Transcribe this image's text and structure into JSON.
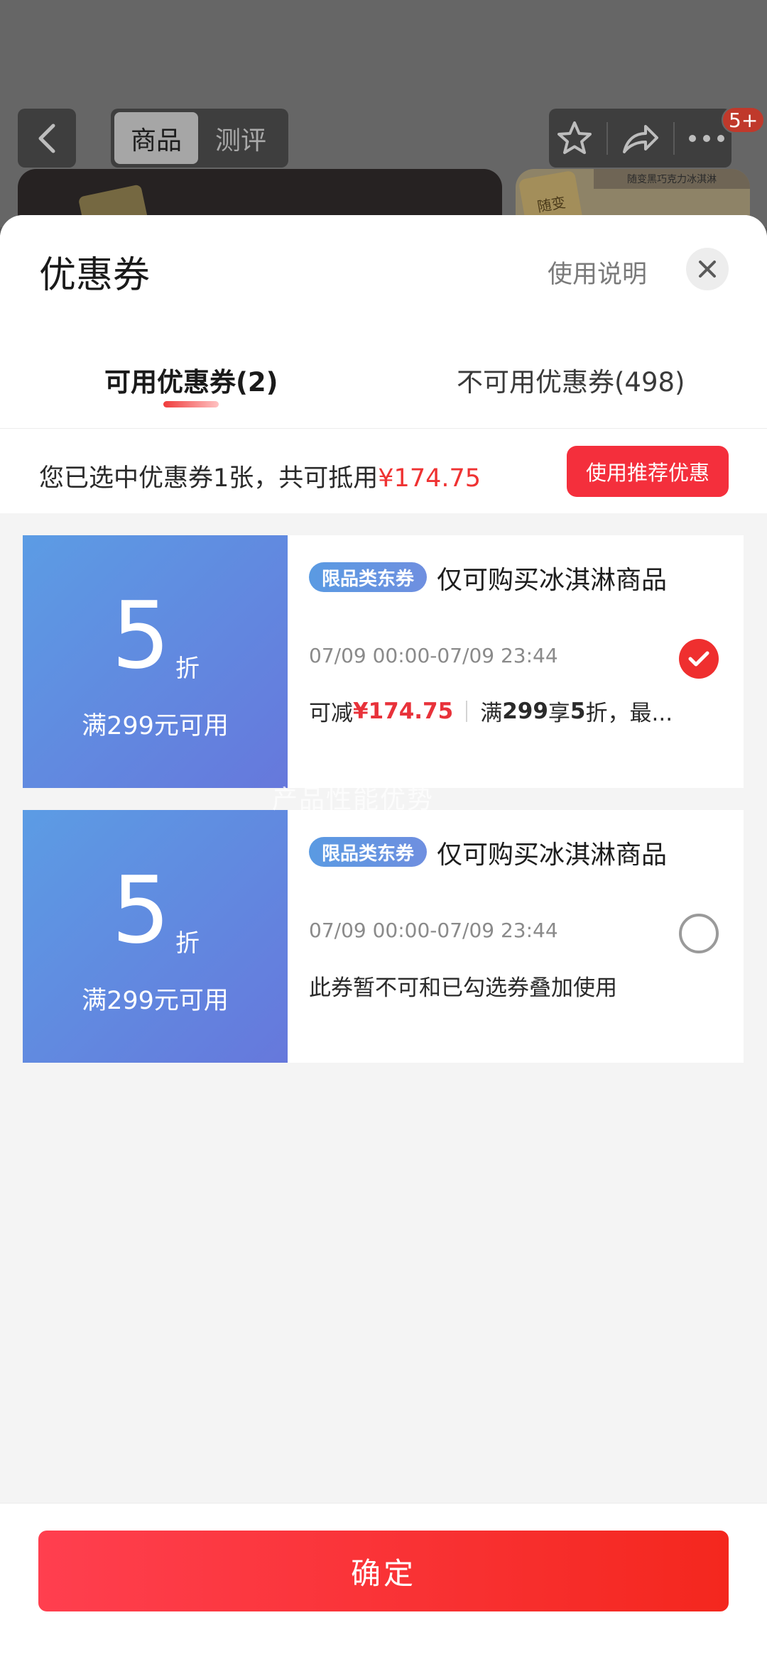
{
  "background_page": {
    "segment_tabs": [
      {
        "label": "商品",
        "active": true
      },
      {
        "label": "测评",
        "active": false
      }
    ],
    "notification_badge": "5+",
    "side_banner_text": "随变黑巧克力冰淇淋",
    "side_logo_text": "随变"
  },
  "sheet": {
    "title": "优惠券",
    "help_link": "使用说明",
    "tabs": [
      {
        "label": "可用优惠券(2)",
        "active": true
      },
      {
        "label": "不可用优惠券(498)",
        "active": false
      }
    ],
    "summary": {
      "prefix": "您已选中优惠券1张，共可抵用",
      "amount": "¥174.75",
      "recommend_button": "使用推荐优惠"
    },
    "coupons": [
      {
        "discount": "5",
        "unit": "折",
        "condition": "满299元可用",
        "tag": "限品类东券",
        "name": "仅可购买冰淇淋商品",
        "validity": "07/09 00:00-07/09 23:44",
        "deduct_prefix": "可减",
        "deduct_amount": "¥174.75",
        "rule_pre": "满",
        "rule_threshold": "299",
        "rule_mid": "享",
        "rule_discount": "5",
        "rule_post": "折，最...",
        "selected": true
      },
      {
        "discount": "5",
        "unit": "折",
        "condition": "满299元可用",
        "tag": "限品类东券",
        "name": "仅可购买冰淇淋商品",
        "validity": "07/09 00:00-07/09 23:44",
        "note": "此券暂不可和已勾选券叠加使用",
        "selected": false
      }
    ],
    "watermark": "产品性能优势",
    "confirm_button": "确定"
  },
  "colors": {
    "accent_red": "#f42f3c",
    "coupon_blue_start": "#5c9ce4",
    "coupon_blue_end": "#6678dc"
  }
}
